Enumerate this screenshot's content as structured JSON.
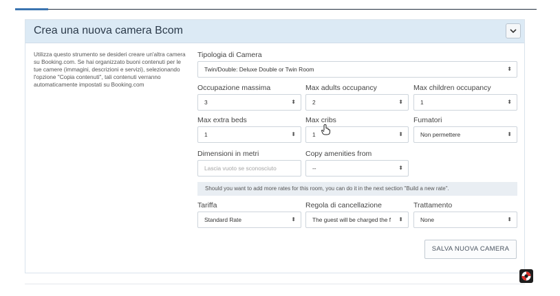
{
  "panel": {
    "title": "Crea una nuova camera Bcom",
    "intro": "Utilizza questo strumento se desideri creare un'altra camera su Booking.com. Se hai organizzato buoni contenuti per le tue camere (immagini, descrizioni e servizi), selezionando l'opzione \"Copia contenuti\", tali contenuti verranno automaticamente impostati su Booking.com"
  },
  "form": {
    "room_type": {
      "label": "Tipologia di Camera",
      "value": "Twin/Double: Deluxe Double or Twin Room"
    },
    "max_occupancy": {
      "label": "Occupazione massima",
      "value": "3"
    },
    "max_adults": {
      "label": "Max adults occupancy",
      "value": "2"
    },
    "max_children": {
      "label": "Max children occupancy",
      "value": "1"
    },
    "extra_beds": {
      "label": "Max extra beds",
      "value": "1"
    },
    "cribs": {
      "label": "Max cribs",
      "value": "1"
    },
    "smokers": {
      "label": "Fumatori",
      "value": "Non permettere"
    },
    "dimensions": {
      "label": "Dimensioni in metri",
      "placeholder": "Lascia vuoto se sconosciuto"
    },
    "copy_amenities": {
      "label": "Copy amenities from",
      "value": "--"
    },
    "notice": "Should you want to add more rates for this room, you can do it in the next section \"Build a new rate\".",
    "rate": {
      "label": "Tariffa",
      "value": "Standard Rate"
    },
    "cancellation": {
      "label": "Regola di cancellazione",
      "value": "The guest will be charged the f"
    },
    "board": {
      "label": "Trattamento",
      "value": "None"
    },
    "save_label": "SALVA NUOVA CAMERA"
  },
  "select_arrows": "⬍",
  "icons": {
    "collapse": "chevron-down-icon",
    "help": "lifebuoy-icon",
    "cursor": "hand-pointer-icon"
  }
}
